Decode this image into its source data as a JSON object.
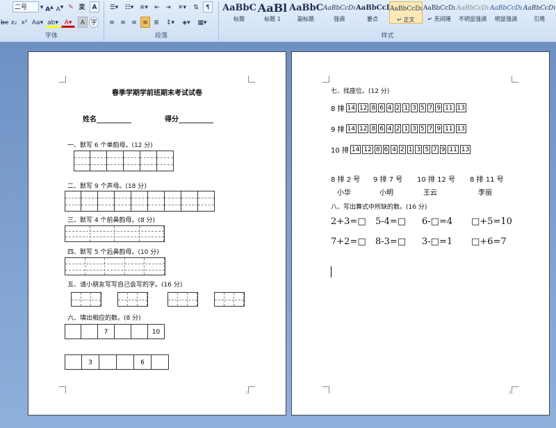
{
  "ribbon": {
    "font_size": "二号",
    "font_label": "字体",
    "paragraph_label": "段落",
    "styles_label": "样式",
    "styles": [
      {
        "preview": "AaBbC",
        "name": "标题"
      },
      {
        "preview": "AaBl",
        "name": "标题 1"
      },
      {
        "preview": "AaBbC",
        "name": "副标题"
      },
      {
        "preview": "AaBbCcDı",
        "name": "强调"
      },
      {
        "preview": "AaBbCcD",
        "name": "要点"
      },
      {
        "preview": "AaBbCcDı",
        "name": "↵ 正文"
      },
      {
        "preview": "AaBbCcDı",
        "name": "↵ 无间隔"
      },
      {
        "preview": "AaBbCcDı",
        "name": "不明显强调"
      },
      {
        "preview": "AaBbCcDı",
        "name": "明显强调"
      },
      {
        "preview": "AaBbCcDı",
        "name": "引用"
      }
    ]
  },
  "page1": {
    "title": "春季学期学前班期末考试试卷",
    "name_label": "姓名__________",
    "score_label": "得分__________",
    "q1": "一、默写 6 个单韵母。(12 分)",
    "q2": "二、默写 9 个声母。(18 分)",
    "q3": "三、默写 4 个前鼻韵母。(8 分)",
    "q4": "四、默写 5 个后鼻韵母。(10 分)",
    "q5": "五、请小朋友写写自己会写的字。(16 分)",
    "q6": "六、填出相应的数。(8 分)",
    "row1": [
      "",
      "",
      "7",
      "",
      "",
      "10"
    ],
    "row2": [
      "",
      "3",
      "",
      "",
      "6",
      ""
    ],
    "page_number": "1"
  },
  "page2": {
    "q7": "七、找座位。(12 分)",
    "seat_rows": [
      {
        "label": "8 排",
        "seats": [
          "14",
          "12",
          "8",
          "6",
          "4",
          "2",
          "1",
          "3",
          "5",
          "7",
          "9",
          "11",
          "13"
        ]
      },
      {
        "label": "9 排",
        "seats": [
          "14",
          "12",
          "8",
          "6",
          "4",
          "2",
          "1",
          "3",
          "5",
          "7",
          "9",
          "11",
          "13"
        ]
      },
      {
        "label": "10 排",
        "seats": [
          "14",
          "12",
          "8",
          "6",
          "4",
          "2",
          "1",
          "3",
          "5",
          "7",
          "9",
          "11",
          "13"
        ]
      }
    ],
    "tickets": [
      {
        "seat": "8 排 2 号",
        "person": "小华"
      },
      {
        "seat": "9 排 7 号",
        "person": "小明"
      },
      {
        "seat": "10 排 12 号",
        "person": "王云"
      },
      {
        "seat": "8 排 11 号",
        "person": "李丽"
      }
    ],
    "q8": "八、写出算式中所缺的数。(16 分)",
    "equations": [
      "2+3=□",
      "5-4=□",
      "6-□=4",
      "□+5=10",
      "7+2=□",
      "8-3=□",
      "3-□=1",
      "□+6=7"
    ],
    "page_number": "2"
  }
}
